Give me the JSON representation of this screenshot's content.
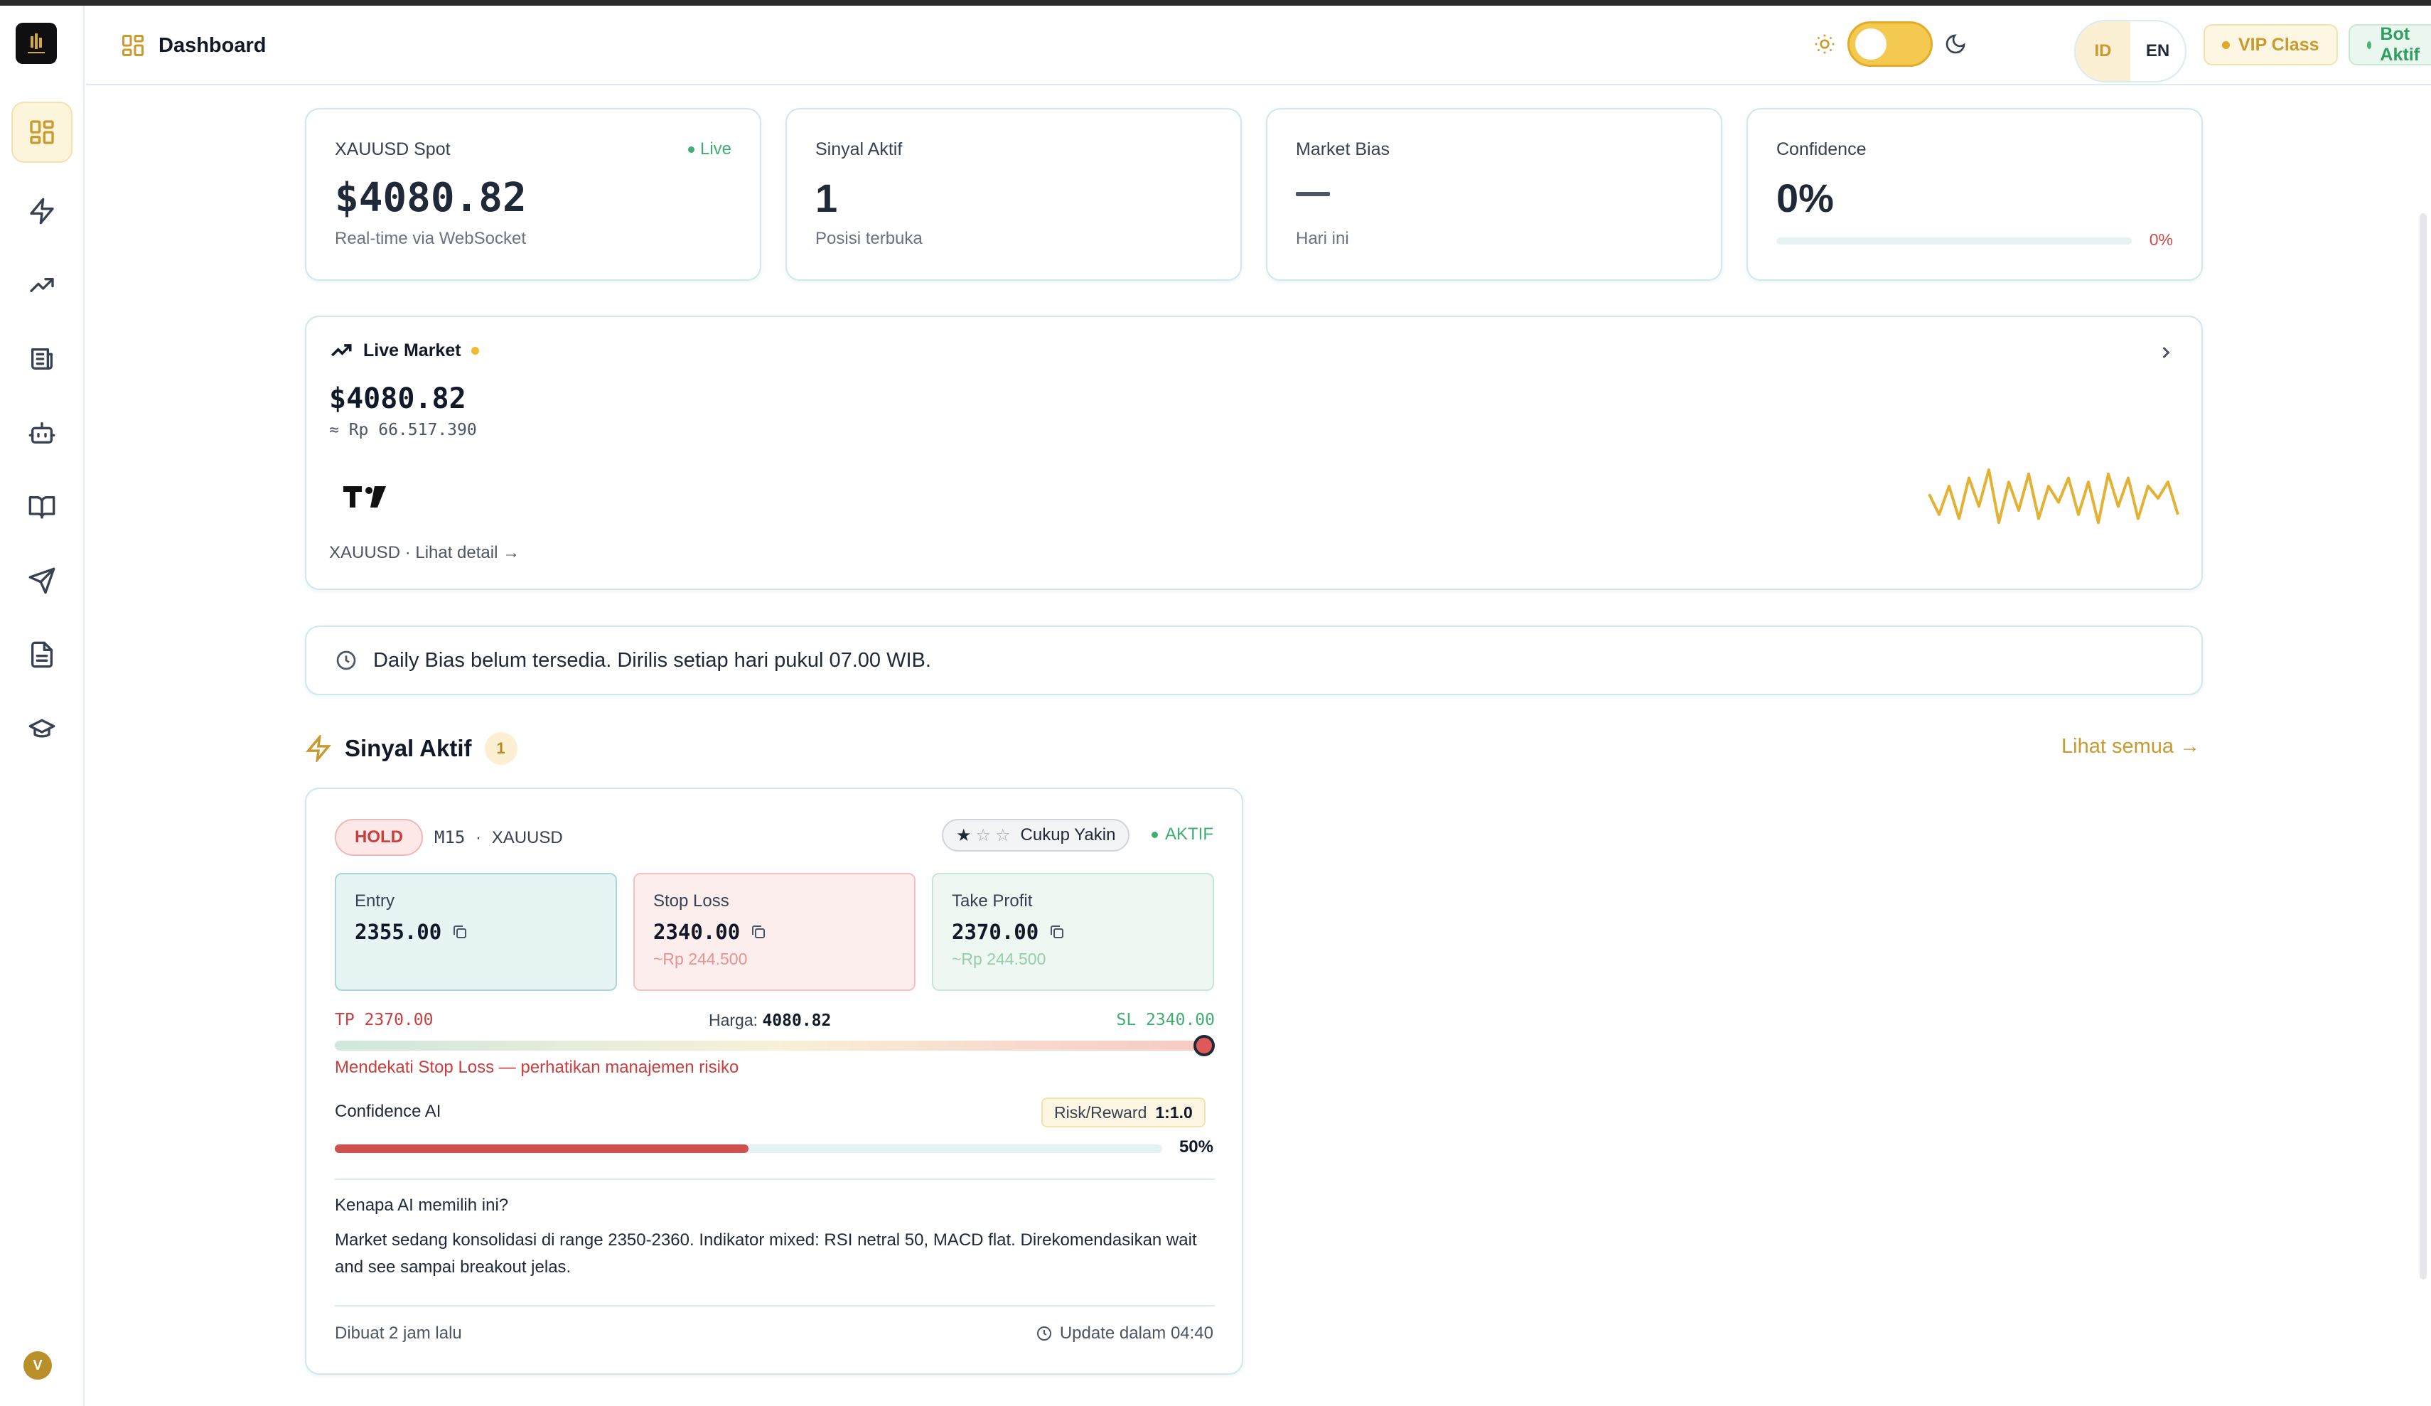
{
  "header": {
    "title": "Dashboard",
    "lang_id": "ID",
    "lang_en": "EN",
    "vip": "VIP Class",
    "bot": "Bot Aktif",
    "theme": "light"
  },
  "sidebar": {
    "items": [
      {
        "icon": "dashboard-icon",
        "active": true
      },
      {
        "icon": "lightning-icon",
        "active": false
      },
      {
        "icon": "trending-up-icon",
        "active": false
      },
      {
        "icon": "newspaper-icon",
        "active": false
      },
      {
        "icon": "bot-icon",
        "active": false
      },
      {
        "icon": "book-icon",
        "active": false
      },
      {
        "icon": "send-icon",
        "active": false
      },
      {
        "icon": "document-icon",
        "active": false
      },
      {
        "icon": "graduation-cap-icon",
        "active": false
      }
    ],
    "avatar": "V"
  },
  "stats": {
    "spot": {
      "label": "XAUUSD Spot",
      "value": "$4080.82",
      "sub": "Real-time via WebSocket",
      "live": "Live"
    },
    "signals": {
      "label": "Sinyal Aktif",
      "value": "1",
      "sub": "Posisi terbuka"
    },
    "bias": {
      "label": "Market Bias",
      "sub": "Hari ini"
    },
    "confidence": {
      "label": "Confidence",
      "value": "0%",
      "pct": "0%",
      "level": 0
    }
  },
  "market": {
    "title": "Live Market",
    "price": "$4080.82",
    "idr": "≈ Rp 66.517.390",
    "link": "XAUUSD · Lihat detail →",
    "sparkline": [
      8,
      3,
      10,
      2,
      12,
      5,
      14,
      1,
      11,
      4,
      13,
      2,
      10,
      6,
      12,
      3,
      11,
      1,
      13,
      5,
      12,
      2,
      10,
      7,
      11,
      3
    ]
  },
  "bias_notice": "Daily Bias belum tersedia. Dirilis setiap hari pukul 07.00 WIB.",
  "section": {
    "title": "Sinyal Aktif",
    "count": "1",
    "see_all": "Lihat semua →"
  },
  "signal": {
    "action": "HOLD",
    "timeframe": "M15",
    "sep": "·",
    "symbol": "XAUUSD",
    "rating_label": "Cukup Yakin",
    "rating_stars": 1,
    "status": "AKTIF",
    "entry": {
      "label": "Entry",
      "value": "2355.00"
    },
    "stop_loss": {
      "label": "Stop Loss",
      "value": "2340.00",
      "idr": "~Rp 244.500"
    },
    "take_profit": {
      "label": "Take Profit",
      "value": "2370.00",
      "idr": "~Rp 244.500"
    },
    "range": {
      "tp": "TP 2370.00",
      "price_label": "Harga:",
      "price": "4080.82",
      "sl": "SL 2340.00",
      "position": 1.0
    },
    "warning": "Mendekati Stop Loss — perhatikan manajemen risiko",
    "confidence_label": "Confidence AI",
    "rr_label": "Risk/Reward",
    "rr_value": "1:1.0",
    "confidence_pct": "50%",
    "confidence_level": 0.5,
    "why_q": "Kenapa AI memilih ini?",
    "why_a": "Market sedang konsolidasi di range 2350-2360. Indikator mixed: RSI netral 50, MACD flat. Direkomendasikan wait and see sampai breakout jelas.",
    "created": "Dibuat 2 jam lalu",
    "update": "Update dalam 04:40"
  },
  "colors": {
    "accent": "#c99a2e",
    "live": "#3fae73",
    "danger": "#cc3d3d",
    "border": "#cfe8ec"
  }
}
